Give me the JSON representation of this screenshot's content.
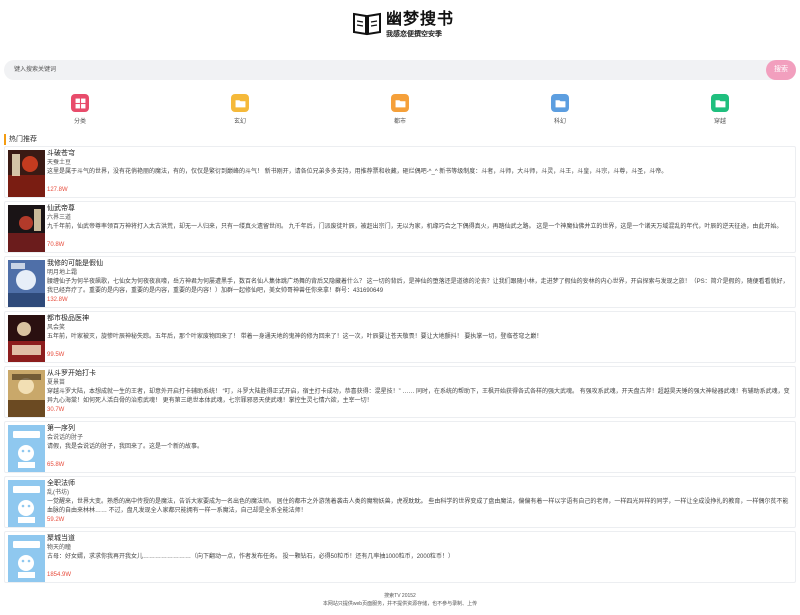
{
  "brand": {
    "title": "幽梦搜书",
    "subtitle": "我感恋便撰空安季"
  },
  "search": {
    "placeholder": "键入搜索关键词",
    "button_label": "搜索"
  },
  "categories": [
    {
      "label": "分类",
      "color": "#e84c6b",
      "icon": "grid-icon"
    },
    {
      "label": "玄幻",
      "color": "#f5b93a",
      "icon": "folder-icon"
    },
    {
      "label": "都市",
      "color": "#f5a03a",
      "icon": "folder-icon"
    },
    {
      "label": "科幻",
      "color": "#5c9ee0",
      "icon": "folder-icon"
    },
    {
      "label": "穿越",
      "color": "#1fbf7e",
      "icon": "folder-icon"
    }
  ],
  "section_title": "热门推荐",
  "books": [
    {
      "title": "斗破苍穹",
      "author": "天蚕土豆",
      "desc": "这里是属于斗气的世界，没有花俏艳丽的魔法，有的，仅仅是繁衍到巅峰的斗气！ 新书刚开，请各位兄弟多多支持，用推荐票和收藏，砸烂偶吧-^_^ 新书等级制度：斗者，斗师，大斗师，斗灵，斗王，斗皇，斗宗，斗尊，斗圣，斗帝。",
      "count": "127.8W"
    },
    {
      "title": "仙武帝尊",
      "author": "六界三道",
      "desc": "九千年前，仙武帝尊率领百万神将打入太古洪荒，却无一人归来，只有一缕真火遗留世间。 九千年后，门派废徒叶辰，被赶出宗门，无以为家，机缘巧合之下偶得真火，再踏仙武之路。 这是一个神魔仙佛并立的世界，这是一个诸天万域混乱的年代，叶辰的逆天征途，由此开始。",
      "count": "70.8W"
    },
    {
      "title": "我修的可能是假仙",
      "author": "明月地上霜",
      "desc": "腰缠仙子为何半夜飙歌，七仙女为何夜夜哀嚎，岳方神君为何屡遭黑手，数百名仙人集体跳广场舞的背后又隐藏着什么？ 这一切的背后，是神仙的堕落还是道德的沦丧？让我们跟随小林，走进梦了假仙的妄林的内心世界，开启探索与发现之旅！（PS：简介是假的，随便看看就好，我已经弃疗了。重要的是内容，重要的是内容，重要的是内容！）加群一起修仙吧，美女帅哥神兽任你来拿！群号：431690649",
      "count": "132.8W"
    },
    {
      "title": "都市极品医神",
      "author": "风会笑",
      "desc": "五年前，叶家被灭，旋惨叶辰神秘失踪。五年后，那个叶家废物回来了！ 带着一身通天地的鬼神的修为回来了！这一次，叶辰要让苍天敬畏！要让大地颤抖！ 要执掌一切，登临苍穹之巅！",
      "count": "99.5W"
    },
    {
      "title": "从斗罗开始打卡",
      "author": "夏景苗",
      "desc": "穿越斗罗大陆，本想成就一生的王者，却意外开启打卡辅助系统！ “叮，斗罗大陆胜得正式开启，宿主打卡成功，恭喜获得：混星技！” …… 同时，在系统的帮助下，王枫开始获得各式各样的强大武魂。 有强攻系武魂，开天盘古斧！超越昊天锤的强大神秘器武魂！有辅助系武魂，变异九心海棠！如何死人活白骨的治愈武魂！ 更有第三绝世本体武魂，七宗罪邪恶天使武魂！掌控生灵七情六欲，主宰一切！",
      "count": "30.7W"
    },
    {
      "title": "第一序列",
      "author": "会说话的肘子",
      "desc": "请假，我是会说话的肘子，我回来了。这是一个新的故事。",
      "count": "65.8W"
    },
    {
      "title": "全职法师",
      "author": "乱(书坊)",
      "desc": "一觉醒来，世界大变。熟悉的高中传授的是魔法，告诉大家要成为一名出色的魔法师。 居住的都市之外游荡着袭击人类的魔物妖兽，虎视眈眈。 些由科学的世界变成了盘由魔法，偏偏有着一样以字语有自己的老师，一样四光异样的同学，一样让全成没挣扎的教育，一样偶尔贫不能血脉的自由来林林…… 不过，盘凡发现全人家都只能拥有一样一系魔法，自己却是全系全能法师！",
      "count": "59.2W"
    },
    {
      "title": "聚城当道",
      "author": "物天的瞳",
      "desc": "古母：好女婿，求求你我再开我女儿……………………（向下翻动一点，作者发布任务。 投一颗钻石，必得50粒币！还有几率抽1000粒币，2000粒币！）",
      "count": "1854.9W"
    }
  ],
  "footer": {
    "line1": "搜索TV  20152",
    "line2": "本网站只提供web页面服务，并不提供资源存储，也不参与录制、上传"
  }
}
